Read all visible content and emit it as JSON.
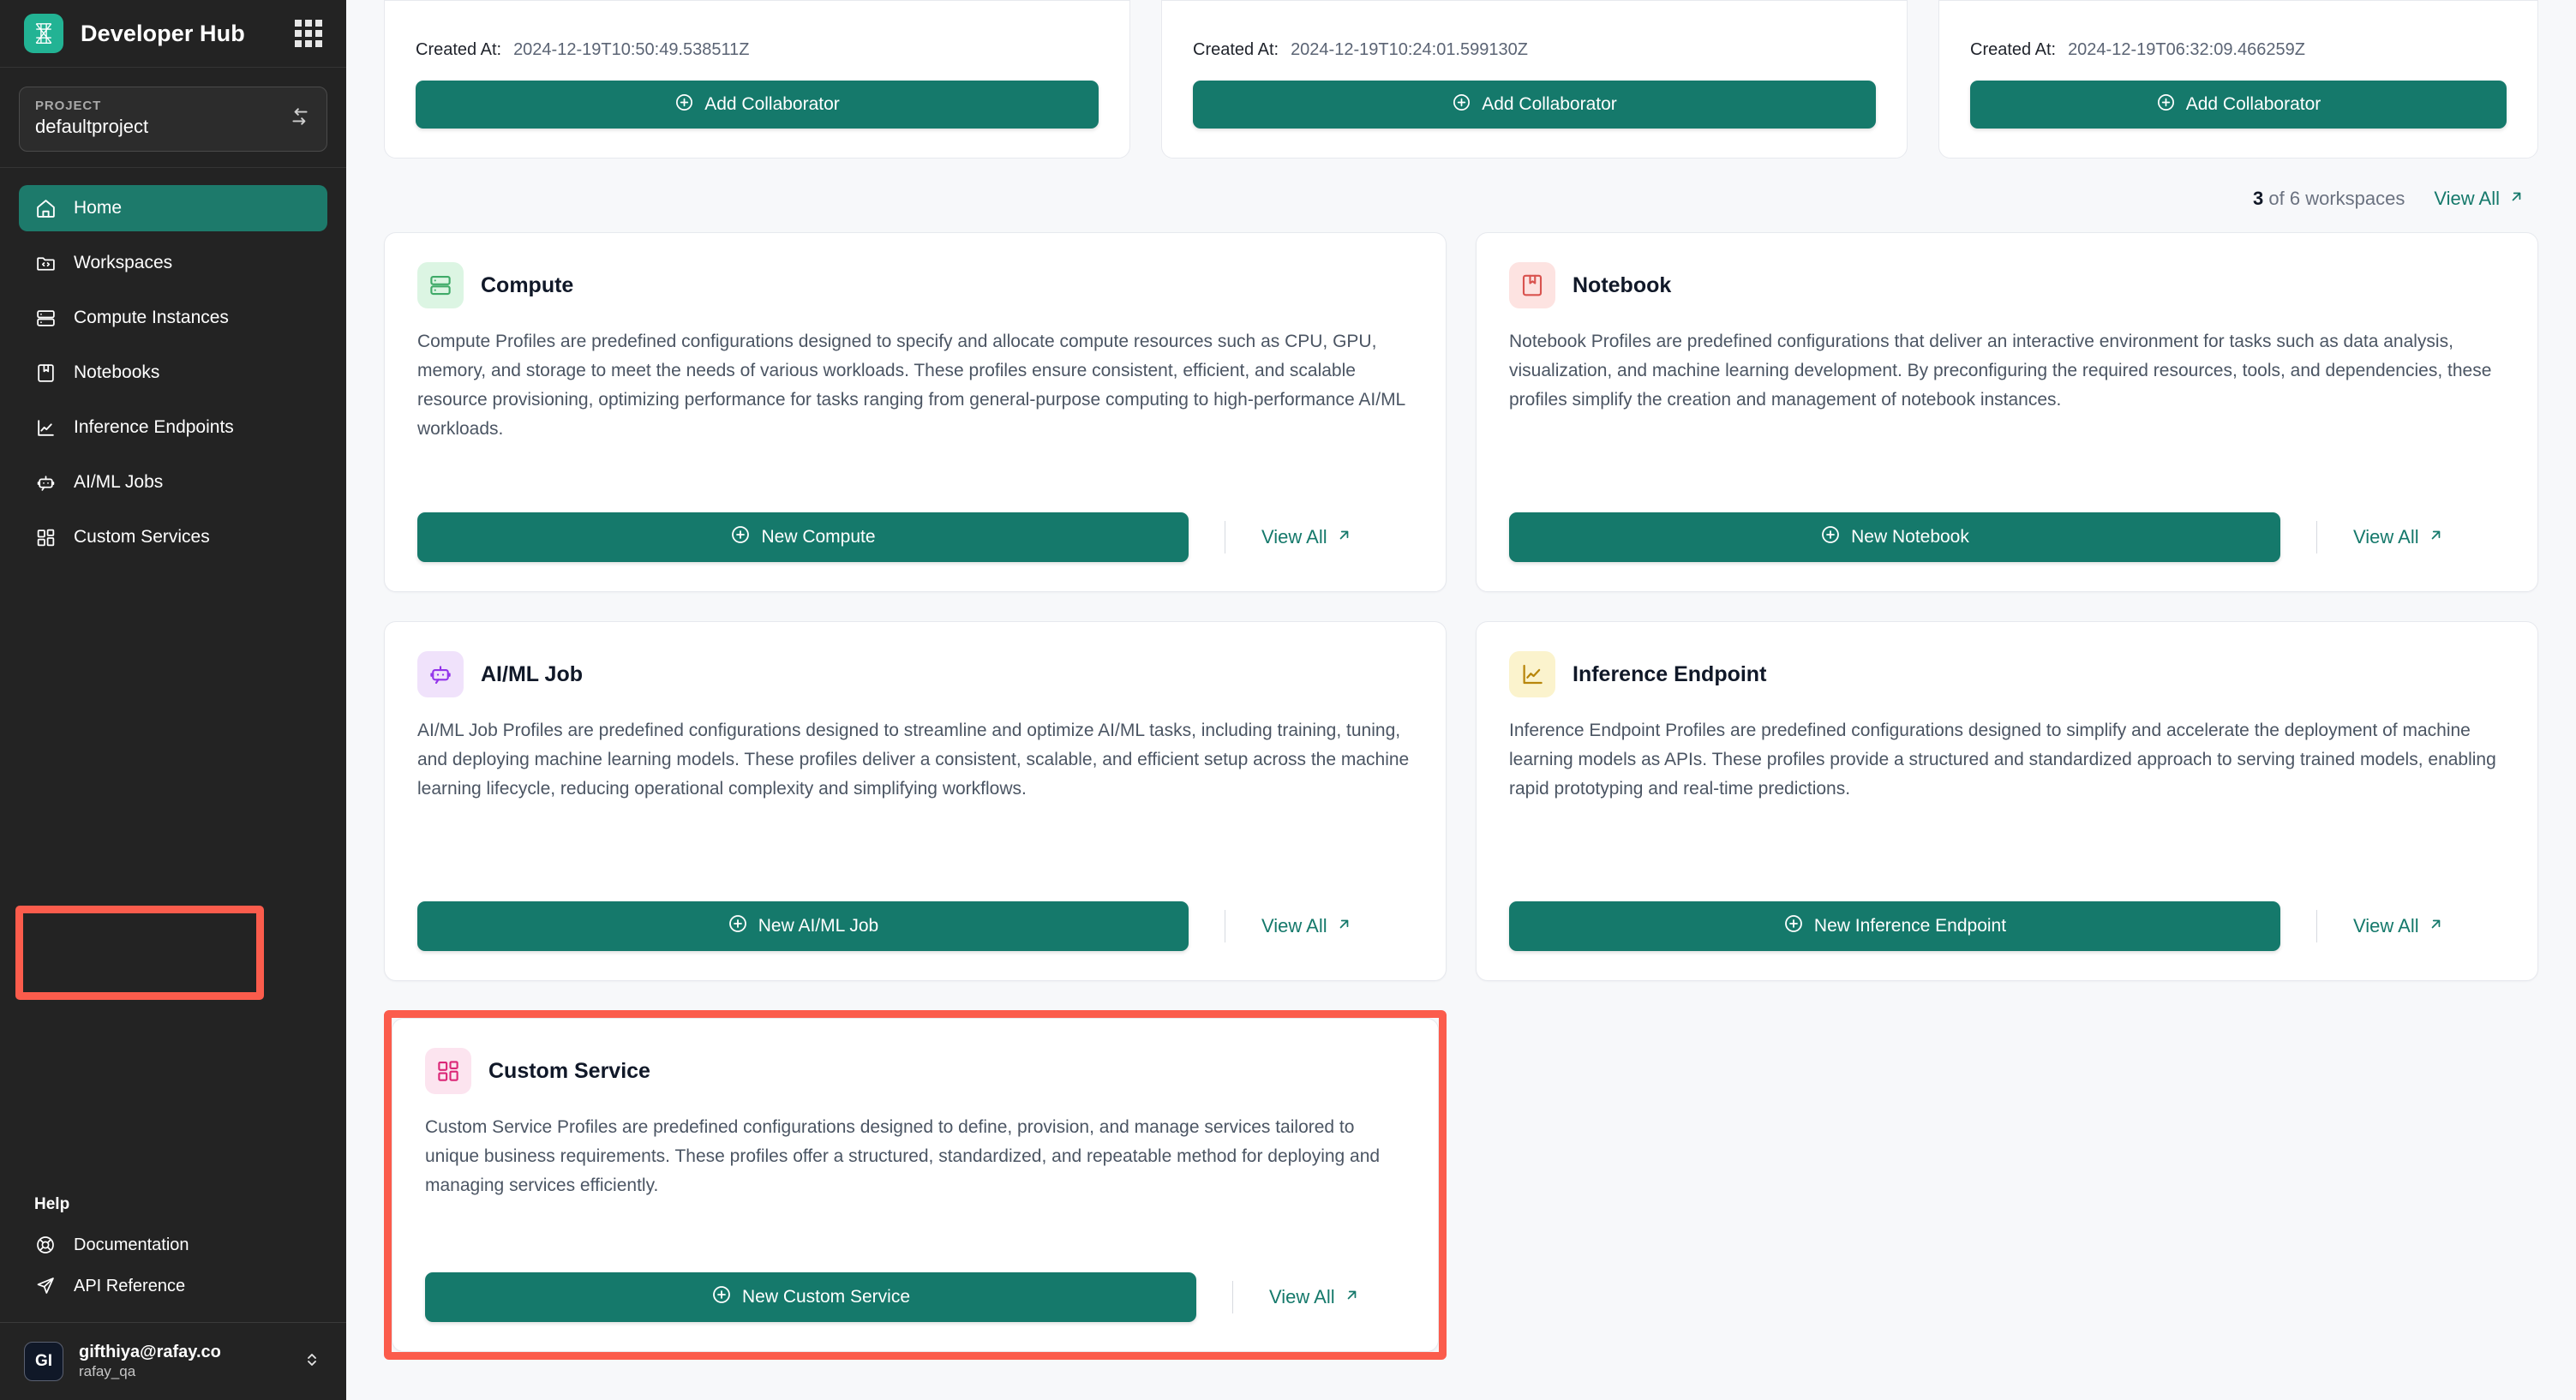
{
  "sidebar": {
    "brand": "Developer Hub",
    "logo_icon": "rafay-logo-icon",
    "apps_icon": "apps-grid-icon",
    "project": {
      "label": "PROJECT",
      "value": "defaultproject",
      "switch_icon": "swap-arrows-icon"
    },
    "items": [
      {
        "label": "Home",
        "icon": "home-icon",
        "active": true
      },
      {
        "label": "Workspaces",
        "icon": "folder-code-icon",
        "active": false
      },
      {
        "label": "Compute Instances",
        "icon": "server-icon",
        "active": false
      },
      {
        "label": "Notebooks",
        "icon": "notebook-icon",
        "active": false
      },
      {
        "label": "Inference Endpoints",
        "icon": "line-chart-icon",
        "active": false
      },
      {
        "label": "AI/ML Jobs",
        "icon": "bot-icon",
        "active": false
      },
      {
        "label": "Custom Services",
        "icon": "layout-blocks-icon",
        "active": false,
        "highlighted": true
      }
    ],
    "help": {
      "title": "Help",
      "items": [
        {
          "label": "Documentation",
          "icon": "lifebuoy-icon"
        },
        {
          "label": "API Reference",
          "icon": "send-icon"
        }
      ]
    },
    "user": {
      "initials": "GI",
      "email": "gifthiya@rafay.co",
      "org": "rafay_qa",
      "chevron_icon": "chevron-up-down-icon"
    }
  },
  "workspaces": {
    "created_label": "Created At:",
    "cards": [
      {
        "created_at": "2024-12-19T10:50:49.538511Z",
        "button": "Add Collaborator"
      },
      {
        "created_at": "2024-12-19T10:24:01.599130Z",
        "button": "Add Collaborator"
      },
      {
        "created_at": "2024-12-19T06:32:09.466259Z",
        "button": "Add Collaborator"
      }
    ],
    "add_icon": "plus-circle-icon",
    "count_number": "3",
    "count_text": " of 6 workspaces",
    "view_all": "View All",
    "view_all_icon": "arrow-up-right-icon"
  },
  "profiles": {
    "view_all": "View All",
    "view_all_icon": "arrow-up-right-icon",
    "add_icon": "plus-circle-icon",
    "compute": {
      "title": "Compute",
      "icon": "server-icon",
      "icon_bg": "#dcf5e3",
      "icon_color": "#3faa68",
      "description": "Compute Profiles are predefined configurations designed to specify and allocate compute resources such as CPU, GPU, memory, and storage to meet the needs of various workloads. These profiles ensure consistent, efficient, and scalable resource provisioning, optimizing performance for tasks ranging from general-purpose computing to high-performance AI/ML workloads.",
      "button": "New Compute"
    },
    "notebook": {
      "title": "Notebook",
      "icon": "notebook-bookmark-icon",
      "icon_bg": "#fde3e1",
      "icon_color": "#d9534f",
      "description": "Notebook Profiles are predefined configurations that deliver an interactive environment for tasks such as data analysis, visualization, and machine learning development. By preconfiguring the required resources, tools, and dependencies, these profiles simplify the creation and management of notebook instances.",
      "button": "New Notebook"
    },
    "aiml_job": {
      "title": "AI/ML Job",
      "icon": "bot-icon",
      "icon_bg": "#f0e2fb",
      "icon_color": "#9333ea",
      "description": "AI/ML Job Profiles are predefined configurations designed to streamline and optimize AI/ML tasks, including training, tuning, and deploying machine learning models. These profiles deliver a consistent, scalable, and efficient setup across the machine learning lifecycle, reducing operational complexity and simplifying workflows.",
      "button": "New AI/ML Job"
    },
    "inference": {
      "title": "Inference Endpoint",
      "icon": "line-chart-icon",
      "icon_bg": "#fbf3cd",
      "icon_color": "#b8860b",
      "description": "Inference Endpoint Profiles are predefined configurations designed to simplify and accelerate the deployment of machine learning models as APIs. These profiles provide a structured and standardized approach to serving trained models, enabling rapid prototyping and real-time predictions.",
      "button": "New Inference Endpoint"
    },
    "custom_service": {
      "title": "Custom Service",
      "icon": "layout-blocks-icon",
      "icon_bg": "#fce4ef",
      "icon_color": "#db2777",
      "description": "Custom Service Profiles are predefined configurations designed to define, provision, and manage services tailored to unique business requirements. These profiles offer a structured, standardized, and repeatable method for deploying and managing services efficiently.",
      "button": "New Custom Service",
      "highlighted": true
    }
  },
  "annotation": {
    "color": "#fb5c4c"
  },
  "cursor": {
    "icon": "mouse-pointer-icon"
  }
}
